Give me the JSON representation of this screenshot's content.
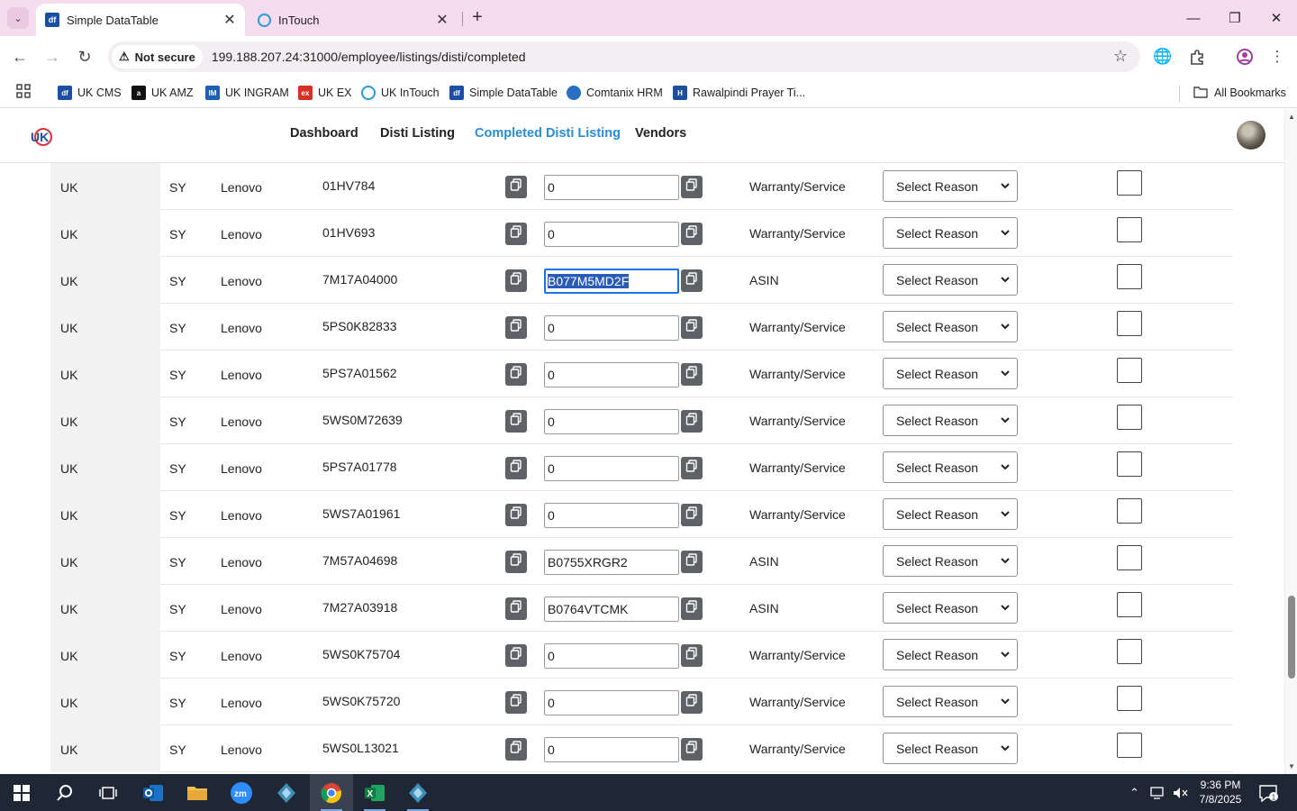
{
  "browser": {
    "tabs": [
      {
        "title": "Simple DataTable",
        "favicon": "df",
        "active": true
      },
      {
        "title": "InTouch",
        "favicon": "intouch-icon",
        "active": false
      }
    ],
    "address": {
      "security_label": "Not secure",
      "url": "199.188.207.24:31000/employee/listings/disti/completed"
    },
    "bookmarks": [
      {
        "label": "UK CMS",
        "icon": "df",
        "color": "#1b4fa3"
      },
      {
        "label": "UK AMZ",
        "icon": "a",
        "color": "#111111"
      },
      {
        "label": "UK INGRAM",
        "icon": "IM",
        "color": "#1d5fb0"
      },
      {
        "label": "UK EX",
        "icon": "ex",
        "color": "#d93025"
      },
      {
        "label": "UK InTouch",
        "icon": "intouch-icon",
        "color": "#2a9ad6"
      },
      {
        "label": "Simple DataTable",
        "icon": "df",
        "color": "#1b4fa3"
      },
      {
        "label": "Comtanix HRM",
        "icon": "hrm-icon",
        "color": "#2a6fc4"
      },
      {
        "label": "Rawalpindi Prayer Ti...",
        "icon": "H",
        "color": "#1d4f9c"
      }
    ],
    "all_bookmarks_label": "All Bookmarks"
  },
  "header": {
    "nav": [
      {
        "label": "Dashboard",
        "active": false
      },
      {
        "label": "Disti Listing",
        "active": false
      },
      {
        "label": "Completed Disti Listing",
        "active": true
      },
      {
        "label": "Vendors",
        "active": false
      }
    ],
    "accent_color": "#2a8cd8"
  },
  "table": {
    "select_placeholder": "Select Reason",
    "rows": [
      {
        "region": "UK",
        "code": "SY",
        "brand": "Lenovo",
        "part": "01HV784",
        "value": "0",
        "type": "Warranty/Service"
      },
      {
        "region": "UK",
        "code": "SY",
        "brand": "Lenovo",
        "part": "01HV693",
        "value": "0",
        "type": "Warranty/Service"
      },
      {
        "region": "UK",
        "code": "SY",
        "brand": "Lenovo",
        "part": "7M17A04000",
        "value": "B077M5MD2F",
        "type": "ASIN",
        "focused": true
      },
      {
        "region": "UK",
        "code": "SY",
        "brand": "Lenovo",
        "part": "5PS0K82833",
        "value": "0",
        "type": "Warranty/Service"
      },
      {
        "region": "UK",
        "code": "SY",
        "brand": "Lenovo",
        "part": "5PS7A01562",
        "value": "0",
        "type": "Warranty/Service"
      },
      {
        "region": "UK",
        "code": "SY",
        "brand": "Lenovo",
        "part": "5WS0M72639",
        "value": "0",
        "type": "Warranty/Service"
      },
      {
        "region": "UK",
        "code": "SY",
        "brand": "Lenovo",
        "part": "5PS7A01778",
        "value": "0",
        "type": "Warranty/Service"
      },
      {
        "region": "UK",
        "code": "SY",
        "brand": "Lenovo",
        "part": "5WS7A01961",
        "value": "0",
        "type": "Warranty/Service"
      },
      {
        "region": "UK",
        "code": "SY",
        "brand": "Lenovo",
        "part": "7M57A04698",
        "value": "B0755XRGR2",
        "type": "ASIN"
      },
      {
        "region": "UK",
        "code": "SY",
        "brand": "Lenovo",
        "part": "7M27A03918",
        "value": "B0764VTCMK",
        "type": "ASIN"
      },
      {
        "region": "UK",
        "code": "SY",
        "brand": "Lenovo",
        "part": "5WS0K75704",
        "value": "0",
        "type": "Warranty/Service"
      },
      {
        "region": "UK",
        "code": "SY",
        "brand": "Lenovo",
        "part": "5WS0K75720",
        "value": "0",
        "type": "Warranty/Service"
      },
      {
        "region": "UK",
        "code": "SY",
        "brand": "Lenovo",
        "part": "5WS0L13021",
        "value": "0",
        "type": "Warranty/Service"
      }
    ]
  },
  "taskbar": {
    "apps": [
      "start-icon",
      "search-icon",
      "task-view-icon",
      "outlook-icon",
      "file-explorer-icon",
      "zoom-icon",
      "app-diamond-icon",
      "chrome-icon",
      "excel-icon",
      "app-diamond-icon"
    ],
    "time": "9:36 PM",
    "date": "7/8/2025",
    "notification_count": "1"
  }
}
